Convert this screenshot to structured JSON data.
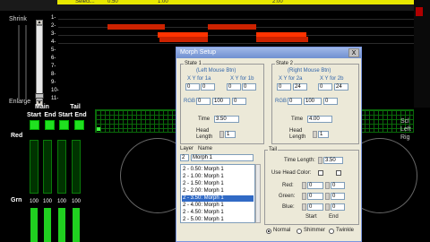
{
  "ruler": {
    "ticks": [
      "Select...",
      "0.50",
      "1:00",
      "2:00"
    ]
  },
  "left": {
    "shrink": "Shrink",
    "enlarge": "Enlarge"
  },
  "rows": [
    "1-",
    "2-",
    "3-",
    "4-",
    "5-",
    "6-",
    "7-",
    "8-",
    "9-",
    "10-",
    "11-"
  ],
  "columns": {
    "main": "Main",
    "tail": "Tail",
    "start": "Start",
    "end": "End",
    "start2": "Start",
    "end2": "End"
  },
  "side_labels": {
    "red": "Red",
    "grn": "Grn"
  },
  "values": {
    "grn1": "100",
    "grn2": "100",
    "grn3": "100",
    "grn4": "100"
  },
  "right_labels": [
    "Scl",
    "Left",
    "Rig"
  ],
  "dialog": {
    "title": "Morph Setup",
    "close": "X",
    "state1": {
      "label": "State 1",
      "sub": "(Left Mouse Btn)",
      "xy1a": "X Y for 1a",
      "xy1b": "X Y for 1b",
      "x1a": "0",
      "y1a": "0",
      "x1b": "0",
      "y1b": "0",
      "rgb": "RGB",
      "r": "0",
      "g": "100",
      "b": "0",
      "time_label": "Time",
      "time": "3.50",
      "head_label": "Head Length",
      "head": "1"
    },
    "state2": {
      "label": "State 2",
      "sub": "(Right Mouse Btn)",
      "xy2a": "X Y for 2a",
      "xy2b": "X Y for 2b",
      "x2a": "0",
      "y2a": "24",
      "x2b": "0",
      "y2b": "24",
      "rgb": "RGB",
      "r": "0",
      "g": "100",
      "b": "0",
      "time_label": "Time",
      "time": "4.00",
      "head_label": "Head Length",
      "head": "1"
    },
    "layer": {
      "label": "Layer",
      "name_label": "Name",
      "num": "2",
      "name": "Morph 1",
      "items": [
        "2 - 0.50: Morph 1",
        "2 - 1.00: Morph 1",
        "2 - 1.50: Morph 1",
        "2 - 2.00: Morph 1",
        "2 - 3.50: Morph 1",
        "2 - 4.00: Morph 1",
        "2 - 4.50: Morph 1",
        "2 - 5.00: Morph 1"
      ],
      "selected_index": 4
    },
    "tail": {
      "label": "Tail",
      "time_length_label": "Time Length:",
      "time_length": "3.50",
      "use_head_color": "Use Head Color:",
      "red": "Red:",
      "green": "Green:",
      "blue": "Blue:",
      "red1": "0",
      "red2": "0",
      "green1": "0",
      "green2": "0",
      "blue1": "0",
      "blue2": "0",
      "start": "Start",
      "end": "End"
    },
    "modes": {
      "normal": "Normal",
      "shimmer": "Shimmer",
      "twinkle": "Twinkle"
    }
  }
}
